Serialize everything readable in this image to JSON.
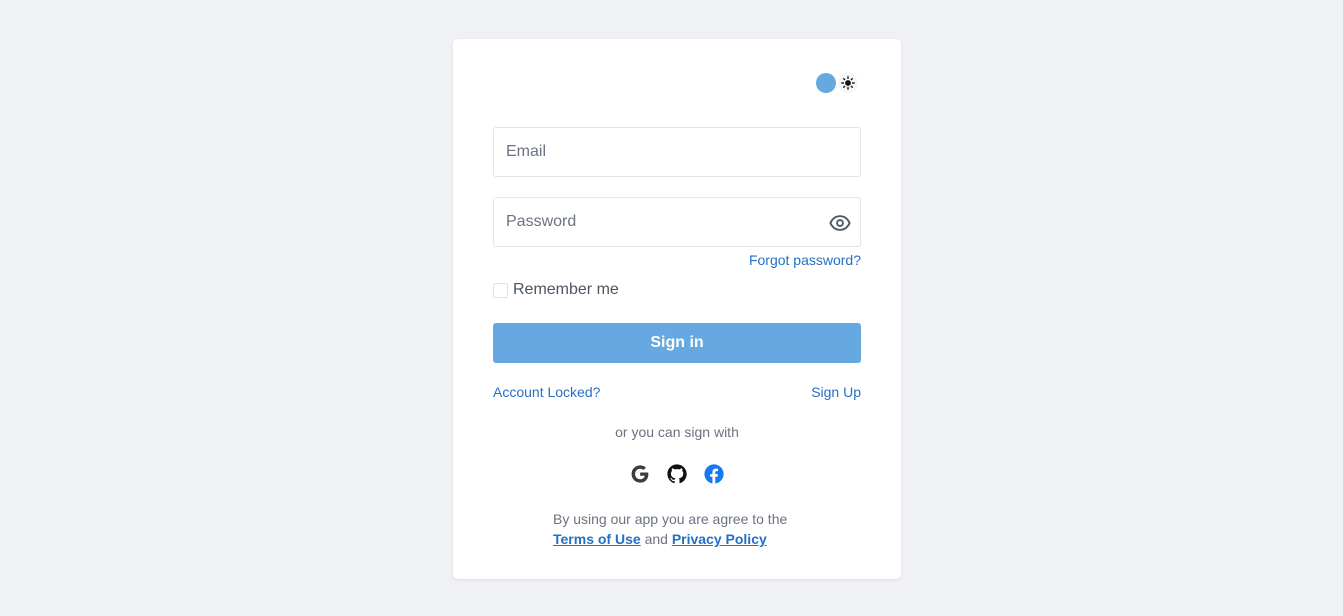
{
  "theme_toggle": {
    "sun_icon": "sun-icon",
    "knob_color": "#66a9e0"
  },
  "email": {
    "placeholder": "Email",
    "value": ""
  },
  "password": {
    "placeholder": "Password",
    "value": "",
    "toggle_icon": "eye-icon"
  },
  "forgot_password": "Forgot password?",
  "remember_me": {
    "label": "Remember me",
    "checked": false
  },
  "sign_in_button": "Sign in",
  "account_locked": "Account Locked?",
  "sign_up": "Sign Up",
  "or_sign_with": "or you can sign with",
  "social_providers": [
    "google-icon",
    "github-icon",
    "facebook-icon"
  ],
  "terms": {
    "line1": "By using our app you are agree to the",
    "terms_link": "Terms of Use",
    "and": "and",
    "privacy_link": "Privacy Policy"
  },
  "colors": {
    "accent": "#66a9e0",
    "link": "#2570c4",
    "background": "#f0f1f5",
    "facebook": "#1877f2"
  }
}
